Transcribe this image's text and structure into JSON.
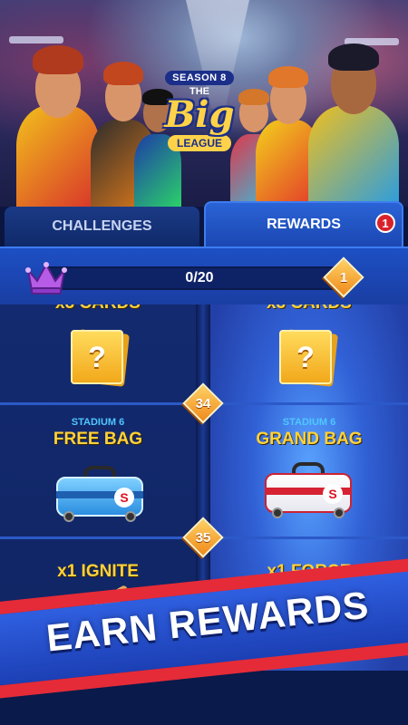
{
  "header": {
    "season_label": "SEASON 8",
    "logo_the": "THE",
    "logo_big": "Big",
    "logo_league": "LEAGUE"
  },
  "tabs": [
    {
      "label": "CHALLENGES",
      "active": false
    },
    {
      "label": "REWARDS",
      "active": true,
      "badge": "1"
    }
  ],
  "progress": {
    "text": "0/20",
    "level": "1",
    "fraction": 0.0
  },
  "tiers": [
    {
      "number": "34"
    },
    {
      "number": "35"
    }
  ],
  "rewards": {
    "row_top": {
      "left": {
        "label": "x3 CARDS",
        "icon": "mystery-card-icon",
        "mark": "?"
      },
      "right": {
        "label": "x3 CARDS",
        "icon": "mystery-card-icon",
        "mark": "?"
      }
    },
    "row_bags": {
      "left": {
        "stadium": "STADIUM 6",
        "name": "FREE BAG",
        "icon": "free-bag-icon",
        "logo": "S"
      },
      "right": {
        "stadium": "STADIUM 6",
        "name": "GRAND BAG",
        "icon": "grand-bag-icon",
        "logo": "S"
      }
    },
    "row_boosts": {
      "left": {
        "name": "x1 IGNITE",
        "icon": "bat-icon"
      },
      "right": {
        "name": "x1 FORCE",
        "icon": "bat-icon"
      }
    }
  },
  "promo": {
    "text": "EARN REWARDS"
  },
  "colors": {
    "gold": "#ffd23a",
    "cyan": "#4fc7ff",
    "tab_active": "#2a63d6",
    "badge": "#d8232a",
    "banner_red": "#e52b38"
  }
}
